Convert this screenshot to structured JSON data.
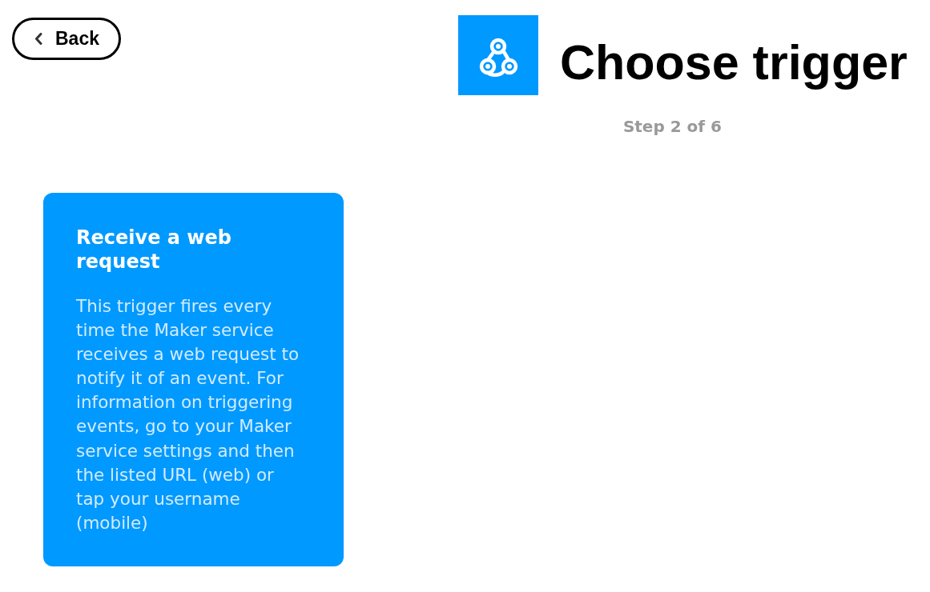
{
  "back_button": {
    "label": "Back"
  },
  "header": {
    "title": "Choose trigger",
    "step": "Step 2 of 6"
  },
  "triggers": [
    {
      "title": "Receive a web request",
      "description": "This trigger fires every time the Maker service receives a web request to notify it of an event. For information on triggering events, go to your Maker service settings and then the listed URL (web) or tap your username (mobile)"
    }
  ]
}
